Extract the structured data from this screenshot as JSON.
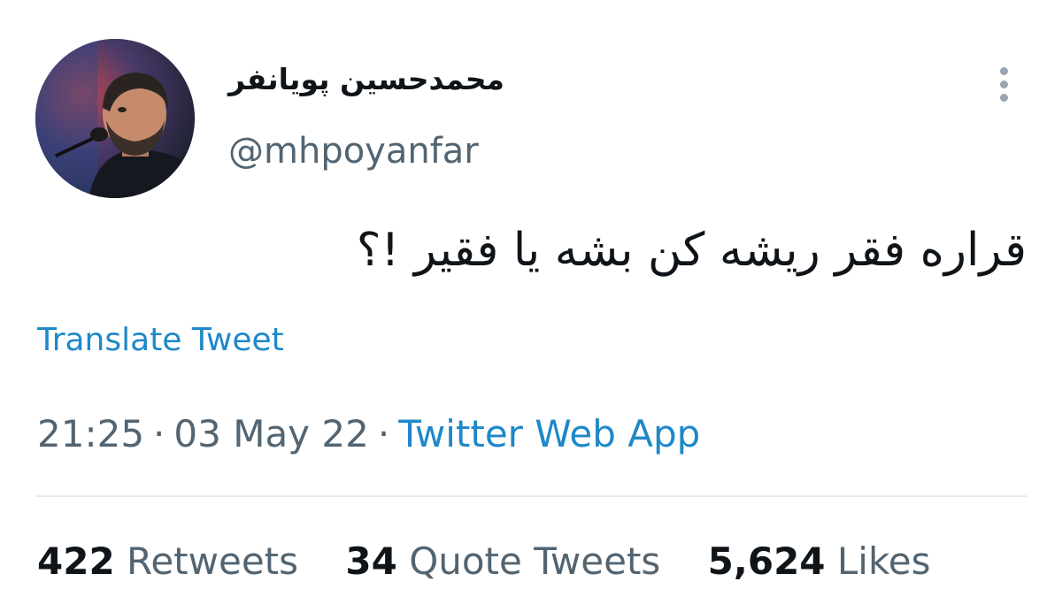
{
  "user": {
    "display_name": "محمدحسین پویانفر",
    "handle": "@mhpoyanfar"
  },
  "tweet": {
    "text": "قراره فقر ریشه کن بشه یا فقیر !؟",
    "translate_label": "Translate Tweet",
    "time": "21:25",
    "date": "03 May 22",
    "source": "Twitter Web App",
    "separator": "·"
  },
  "stats": {
    "retweets_count": "422",
    "retweets_label": "Retweets",
    "quotes_count": "34",
    "quotes_label": "Quote Tweets",
    "likes_count": "5,624",
    "likes_label": "Likes"
  },
  "icons": {
    "more": "more-vertical-icon"
  },
  "colors": {
    "link": "#1e88c9",
    "muted": "#536471",
    "text": "#0f1419",
    "divider": "#e6ecf0"
  }
}
